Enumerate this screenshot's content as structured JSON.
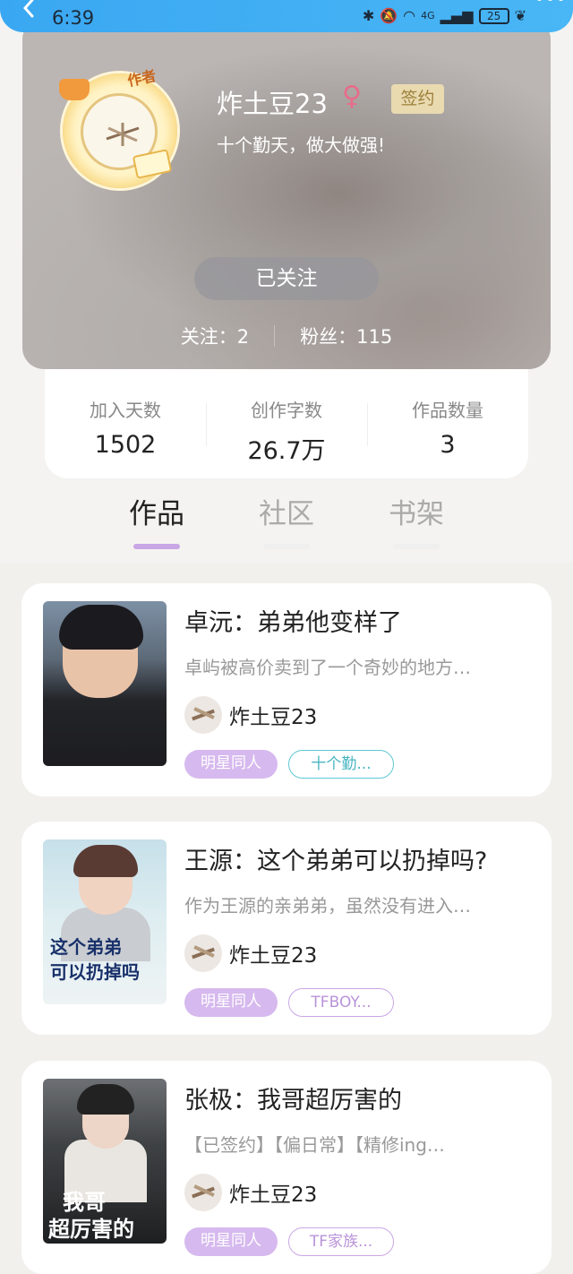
{
  "status_bar": {
    "time": "6:39",
    "battery": "25",
    "network": "4G"
  },
  "profile": {
    "username": "炸土豆23",
    "gender_symbol": "♀",
    "signed_badge": "签约",
    "motto": "十个勤天，做大做强!",
    "avatar_tag": "作者",
    "follow_button": "已关注",
    "following_label": "关注：",
    "following_count": "2",
    "fans_label": "粉丝：",
    "fans_count": "115"
  },
  "stats": [
    {
      "label": "加入天数",
      "value": "1502"
    },
    {
      "label": "创作字数",
      "value": "26.7万"
    },
    {
      "label": "作品数量",
      "value": "3"
    }
  ],
  "tabs": [
    {
      "label": "作品",
      "active": true
    },
    {
      "label": "社区",
      "active": false
    },
    {
      "label": "书架",
      "active": false
    }
  ],
  "books": [
    {
      "title": "卓沅：弟弟他变样了",
      "description": "卓屿被高价卖到了一个奇妙的地方…",
      "author": "炸土豆23",
      "genre_tag": "明星同人",
      "extra_tag": "十个勤...",
      "extra_tag_color": "#5ec7d2"
    },
    {
      "title": "王源：这个弟弟可以扔掉吗?",
      "description": "作为王源的亲弟弟，虽然没有进入…",
      "author": "炸土豆23",
      "genre_tag": "明星同人",
      "extra_tag": "TFBOY...",
      "extra_tag_color": "#c9a6e6",
      "cover_text_1": "这个弟弟",
      "cover_text_2": "可以扔掉吗"
    },
    {
      "title": "张极：我哥超厉害的",
      "description": "【已签约】【偏日常】【精修ing…",
      "author": "炸土豆23",
      "genre_tag": "明星同人",
      "extra_tag": "TF家族...",
      "extra_tag_color": "#c9a6e6",
      "cover_text_1": "我哥",
      "cover_text_2": "超厉害的"
    }
  ]
}
